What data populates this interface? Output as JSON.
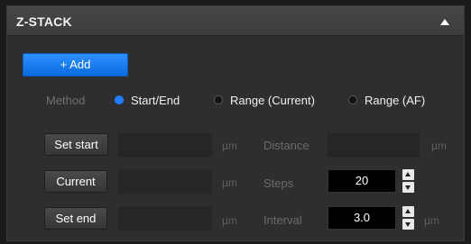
{
  "panel": {
    "title": "Z-STACK",
    "collapse_icon": "triangle-up-icon"
  },
  "add_label": "+ Add",
  "method": {
    "label": "Method",
    "options": [
      "Start/End",
      "Range (Current)",
      "Range (AF)"
    ],
    "selected": "Start/End"
  },
  "rows": {
    "set_start_label": "Set start",
    "current_label": "Current",
    "set_end_label": "Set end",
    "unit": "µm"
  },
  "fields": {
    "start_value": "",
    "current_value": "",
    "end_value": "",
    "distance_label": "Distance",
    "distance_value": "",
    "steps_label": "Steps",
    "steps_value": "20",
    "interval_label": "Interval",
    "interval_value": "3.0"
  },
  "colors": {
    "accent": "#1f7fff",
    "panel_bg": "#2e2e2e"
  }
}
